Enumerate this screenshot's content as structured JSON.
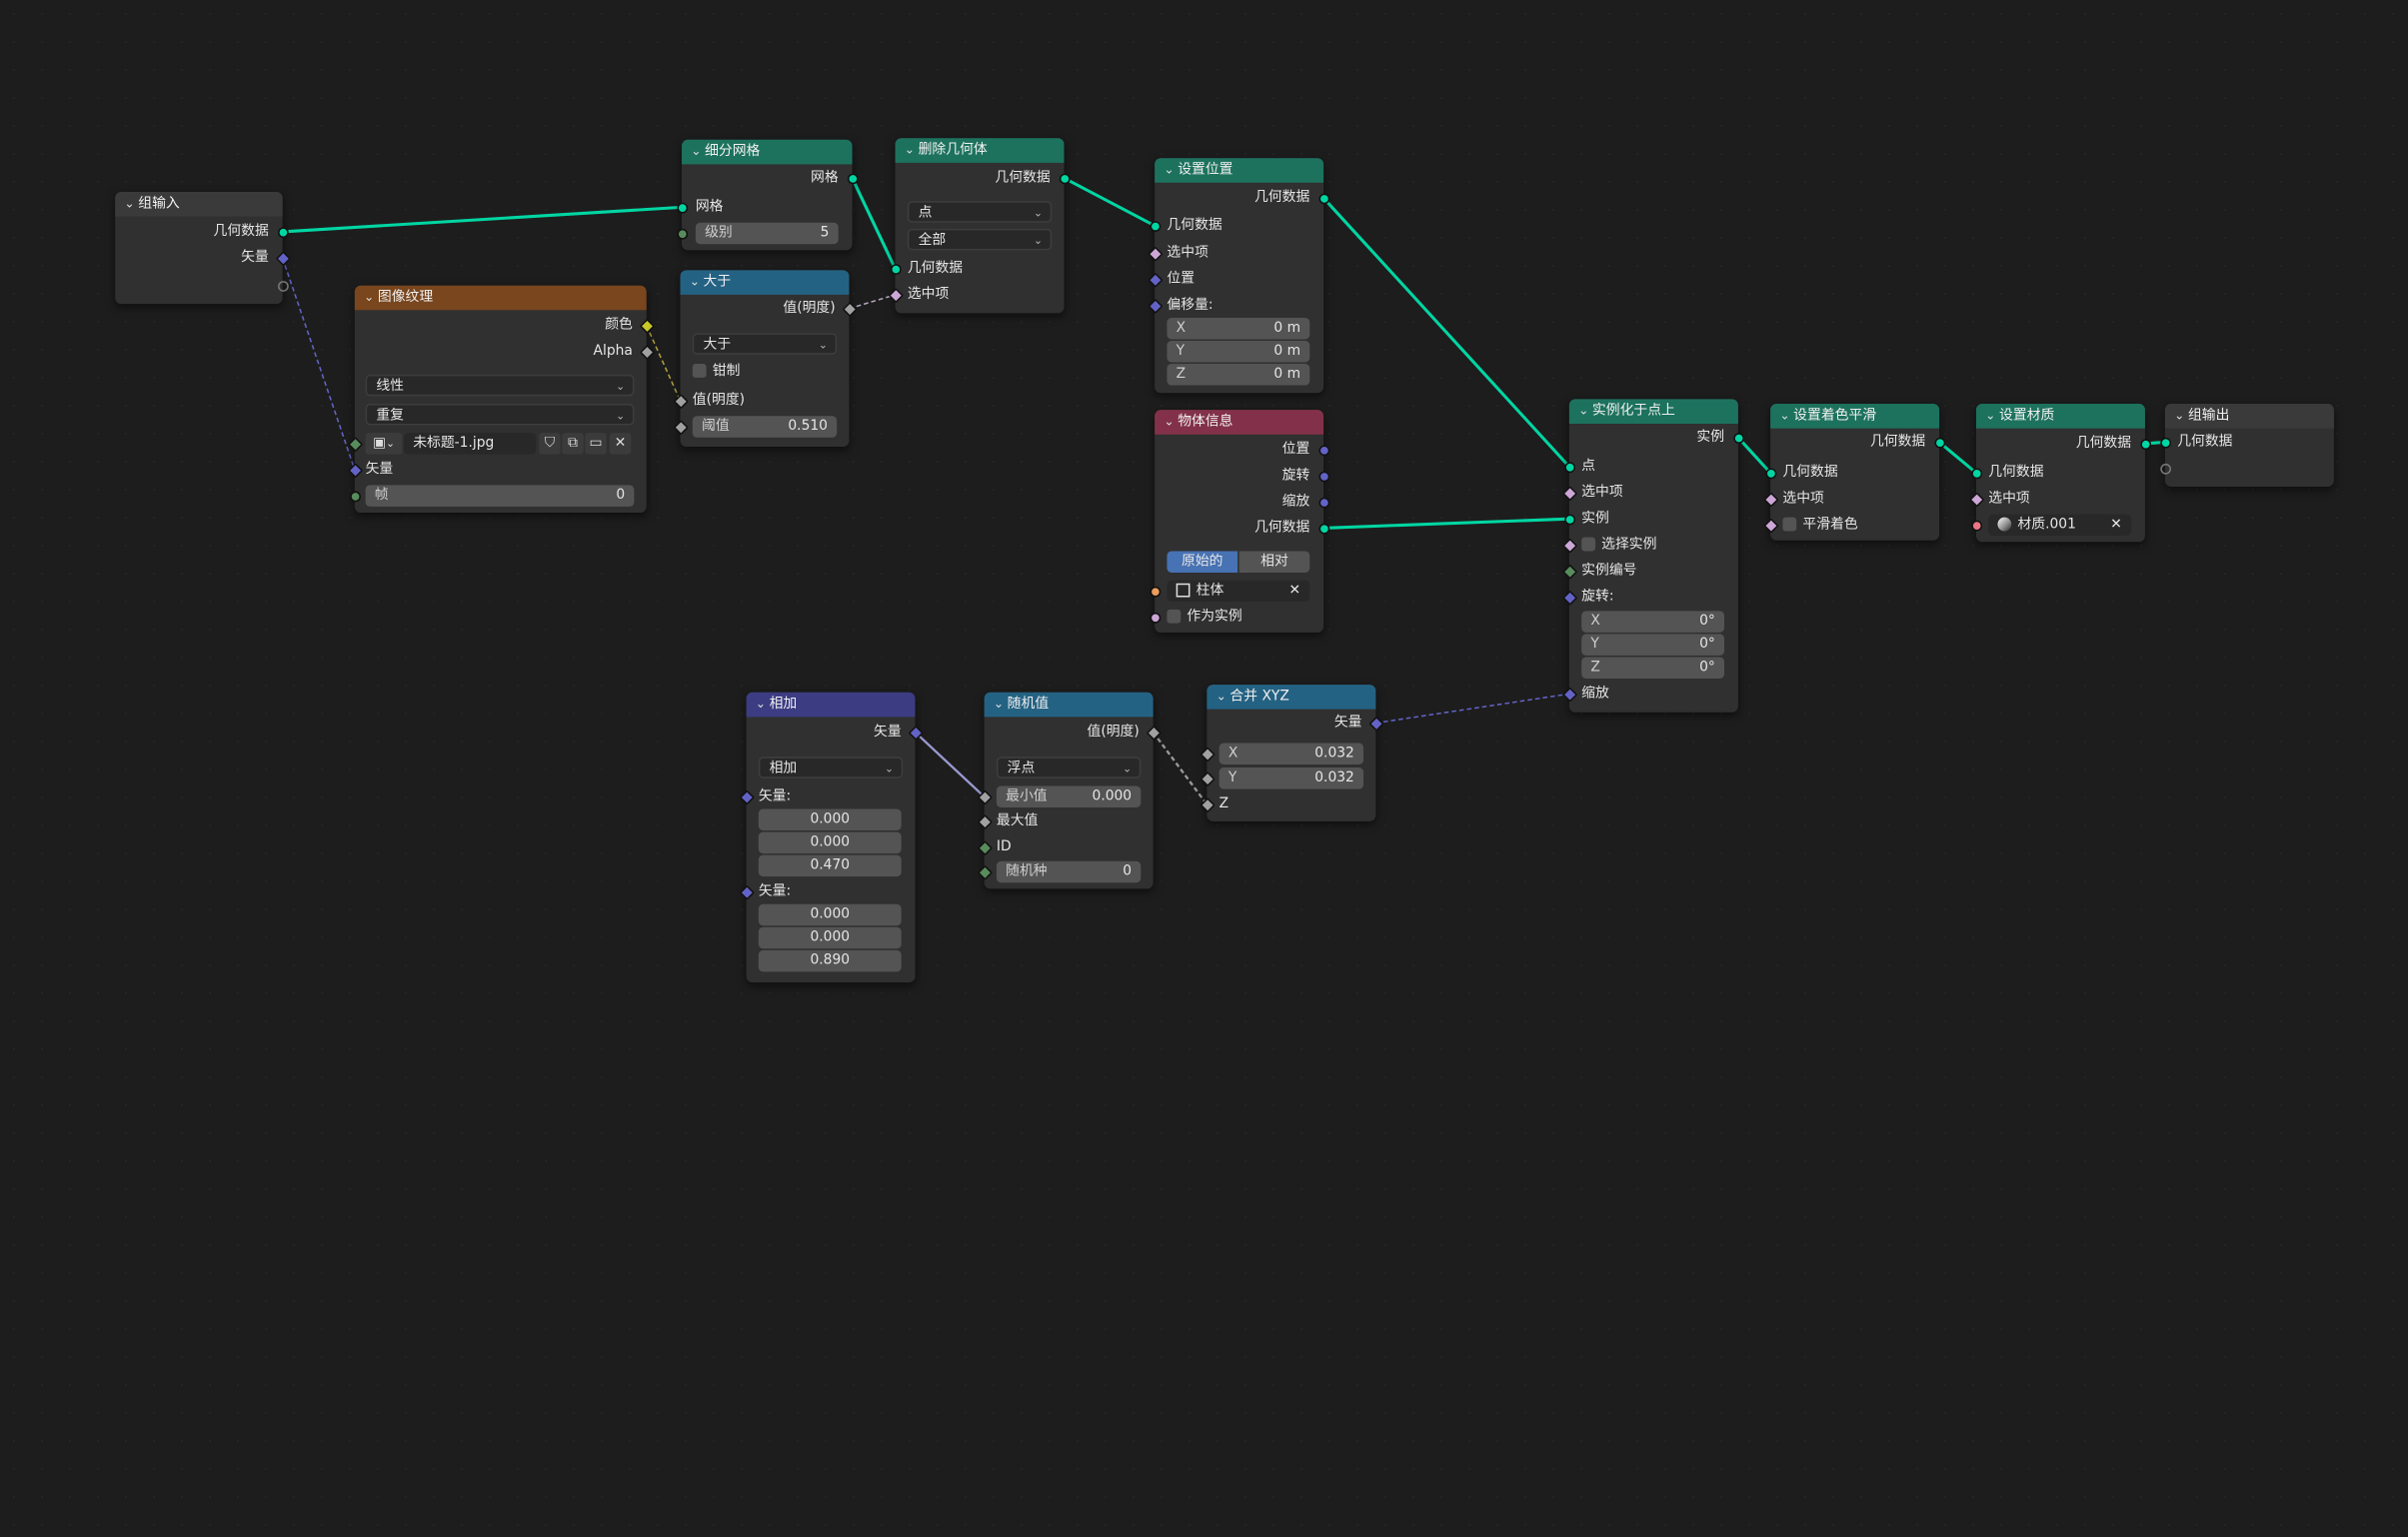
{
  "nodes": {
    "group_input": {
      "title": "组输入",
      "geometry": "几何数据",
      "vector": "矢量"
    },
    "image_texture": {
      "title": "图像纹理",
      "color": "颜色",
      "alpha": "Alpha",
      "interpolation": "线性",
      "extension": "重复",
      "image_name": "未标题-1.jpg",
      "vector": "矢量",
      "frame_label": "帧",
      "frame_value": "0"
    },
    "subdivide": {
      "title": "细分网格",
      "mesh_out": "网格",
      "mesh_in": "网格",
      "level_label": "级别",
      "level_value": "5"
    },
    "greater": {
      "title": "大于",
      "value_out": "值(明度)",
      "operation": "大于",
      "clamp": "钳制",
      "value_in": "值(明度)",
      "threshold_label": "阈值",
      "threshold_value": "0.510"
    },
    "delete_geometry": {
      "title": "删除几何体",
      "geometry_out": "几何数据",
      "domain": "点",
      "mode": "全部",
      "geometry_in": "几何数据",
      "selection": "选中项"
    },
    "set_position": {
      "title": "设置位置",
      "geometry_out": "几何数据",
      "geometry_in": "几何数据",
      "selection": "选中项",
      "position": "位置",
      "offset": "偏移量:",
      "x_label": "X",
      "x_value": "0 m",
      "y_label": "Y",
      "y_value": "0 m",
      "z_label": "Z",
      "z_value": "0 m"
    },
    "object_info": {
      "title": "物体信息",
      "location": "位置",
      "rotation": "旋转",
      "scale": "缩放",
      "geometry": "几何数据",
      "mode_original": "原始的",
      "mode_relative": "相对",
      "object_name": "柱体",
      "as_instance": "作为实例"
    },
    "instance_on_points": {
      "title": "实例化于点上",
      "instances_out": "实例",
      "points": "点",
      "selection": "选中项",
      "instance": "实例",
      "pick_instance": "选择实例",
      "instance_index": "实例编号",
      "rotation": "旋转:",
      "rx_label": "X",
      "rx_value": "0°",
      "ry_label": "Y",
      "ry_value": "0°",
      "rz_label": "Z",
      "rz_value": "0°",
      "scale": "缩放"
    },
    "set_shade_smooth": {
      "title": "设置着色平滑",
      "geometry_out": "几何数据",
      "geometry_in": "几何数据",
      "selection": "选中项",
      "shade_smooth": "平滑着色"
    },
    "set_material": {
      "title": "设置材质",
      "geometry_out": "几何数据",
      "geometry_in": "几何数据",
      "selection": "选中项",
      "material": "材质.001"
    },
    "group_output": {
      "title": "组输出",
      "geometry": "几何数据"
    },
    "add": {
      "title": "相加",
      "vector_out": "矢量",
      "operation": "相加",
      "vector_a": "矢量:",
      "a_x": "0.000",
      "a_y": "0.000",
      "a_z": "0.470",
      "vector_b": "矢量:",
      "b_x": "0.000",
      "b_y": "0.000",
      "b_z": "0.890"
    },
    "random_value": {
      "title": "随机值",
      "value_out": "值(明度)",
      "data_type": "浮点",
      "min_label": "最小值",
      "min_value": "0.000",
      "max": "最大值",
      "id": "ID",
      "seed_label": "随机种",
      "seed_value": "0"
    },
    "combine_xyz": {
      "title": "合并 XYZ",
      "vector_out": "矢量",
      "x_label": "X",
      "x_value": "0.032",
      "y_label": "Y",
      "y_value": "0.032",
      "z": "Z"
    }
  },
  "colors": {
    "background": "#1d1d1d",
    "node_body": "#303030",
    "geometry_header": "#1d725e",
    "texture_header": "#79461d",
    "utility_header": "#246283",
    "input_header": "#3a3a3a",
    "object_header": "#83314a",
    "vector_header": "#3c3c83",
    "geometry_link": "#00d6a3",
    "vector_link": "#6363c7",
    "float_link": "#a1a1a1",
    "boolean_link": "#cca6d6"
  },
  "icons": [
    "chevron-down-icon",
    "image-icon",
    "shield-icon",
    "duplicate-icon",
    "folder-icon",
    "close-icon",
    "object-icon",
    "material-icon"
  ]
}
